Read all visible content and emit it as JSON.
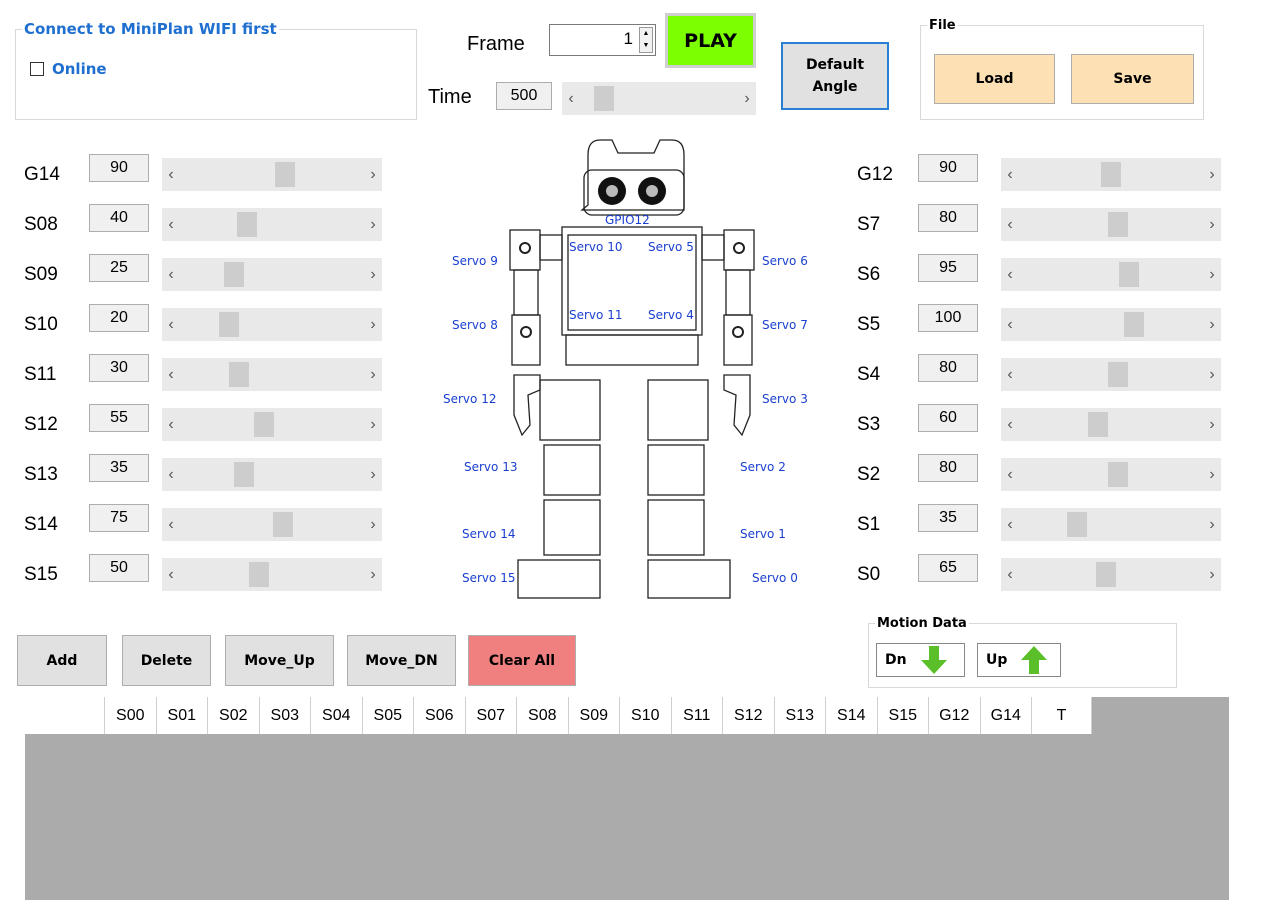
{
  "connection": {
    "legend": "Connect to MiniPlan WIFI first",
    "online_label": "Online"
  },
  "frame": {
    "label": "Frame",
    "value": "1"
  },
  "play_label": "PLAY",
  "time": {
    "label": "Time",
    "value": "500",
    "slider_level": 0.1
  },
  "default_angle_label": "Default\nAngle",
  "file": {
    "legend": "File",
    "load_label": "Load",
    "save_label": "Save"
  },
  "left_servos": [
    {
      "name": "G14",
      "value": "90",
      "level": 0.58
    },
    {
      "name": "S08",
      "value": "40",
      "level": 0.35
    },
    {
      "name": "S09",
      "value": "25",
      "level": 0.27
    },
    {
      "name": "S10",
      "value": "20",
      "level": 0.24
    },
    {
      "name": "S11",
      "value": "30",
      "level": 0.3
    },
    {
      "name": "S12",
      "value": "55",
      "level": 0.45
    },
    {
      "name": "S13",
      "value": "35",
      "level": 0.33
    },
    {
      "name": "S14",
      "value": "75",
      "level": 0.57
    },
    {
      "name": "S15",
      "value": "50",
      "level": 0.42
    }
  ],
  "right_servos": [
    {
      "name": "G12",
      "value": "90",
      "level": 0.5
    },
    {
      "name": "S7",
      "value": "80",
      "level": 0.54
    },
    {
      "name": "S6",
      "value": "95",
      "level": 0.61
    },
    {
      "name": "S5",
      "value": "100",
      "level": 0.64
    },
    {
      "name": "S4",
      "value": "80",
      "level": 0.54
    },
    {
      "name": "S3",
      "value": "60",
      "level": 0.42
    },
    {
      "name": "S2",
      "value": "80",
      "level": 0.54
    },
    {
      "name": "S1",
      "value": "35",
      "level": 0.29
    },
    {
      "name": "S0",
      "value": "65",
      "level": 0.47
    }
  ],
  "robot_labels": {
    "gpio": "GPIO12",
    "servo0": "Servo 0",
    "servo1": "Servo 1",
    "servo2": "Servo 2",
    "servo3": "Servo 3",
    "servo4": "Servo 4",
    "servo5": "Servo 5",
    "servo6": "Servo 6",
    "servo7": "Servo 7",
    "servo8": "Servo 8",
    "servo9": "Servo 9",
    "servo10": "Servo 10",
    "servo11": "Servo 11",
    "servo12": "Servo 12",
    "servo13": "Servo 13",
    "servo14": "Servo 14",
    "servo15": "Servo 15"
  },
  "actions": {
    "add": "Add",
    "delete": "Delete",
    "move_up": "Move_Up",
    "move_dn": "Move_DN",
    "clear_all": "Clear All"
  },
  "motion_data": {
    "legend": "Motion Data",
    "dn_label": "Dn",
    "up_label": "Up"
  },
  "grid_columns": [
    "",
    "S00",
    "S01",
    "S02",
    "S03",
    "S04",
    "S05",
    "S06",
    "S07",
    "S08",
    "S09",
    "S10",
    "S11",
    "S12",
    "S13",
    "S14",
    "S15",
    "G12",
    "G14",
    "T"
  ],
  "colors": {
    "accent": "#1e6fd0",
    "play": "#7cff00",
    "file_btn": "#fde0b4",
    "clear_all": "#f08080",
    "grid_bg": "#ababab",
    "arrow_green": "#5bbf2a"
  }
}
